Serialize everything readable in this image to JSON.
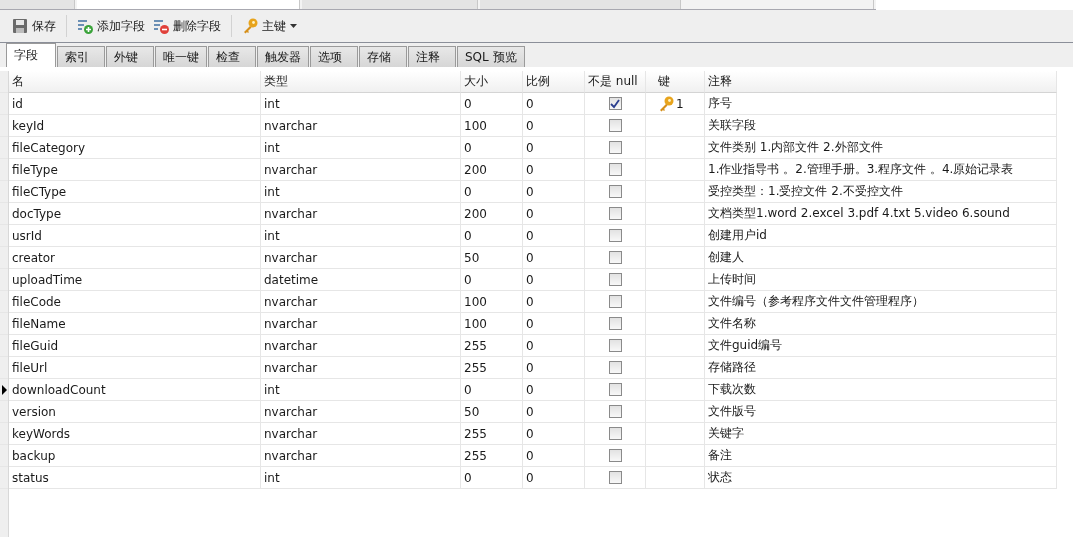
{
  "document_tabs": [
    {
      "selected": false
    },
    {
      "selected": true
    },
    {
      "selected": false
    },
    {
      "selected": false
    },
    {
      "selected": false
    }
  ],
  "toolbar": [
    {
      "kind": "save",
      "label": "保存"
    },
    {
      "kind": "separator"
    },
    {
      "kind": "add",
      "label": "添加字段"
    },
    {
      "kind": "delete",
      "label": "删除字段"
    },
    {
      "kind": "separator"
    },
    {
      "kind": "key",
      "label": "主键",
      "dropdown": true
    }
  ],
  "tabs": [
    {
      "label": "字段",
      "selected": true
    },
    {
      "label": "索引",
      "selected": false
    },
    {
      "label": "外键",
      "selected": false
    },
    {
      "label": "唯一键",
      "selected": false
    },
    {
      "label": "检查",
      "selected": false
    },
    {
      "label": "触发器",
      "selected": false
    },
    {
      "label": "选项",
      "selected": false
    },
    {
      "label": "存储",
      "selected": false
    },
    {
      "label": "注释",
      "selected": false
    },
    {
      "label": "SQL 预览",
      "selected": false
    }
  ],
  "table": {
    "columns": [
      "名",
      "类型",
      "大小",
      "比例",
      "不是 null",
      "键",
      "注释"
    ],
    "rows": [
      {
        "name": "id",
        "type": "int",
        "size": "0",
        "scale": "0",
        "not_null": true,
        "key": "1",
        "comment": "序号",
        "current": false
      },
      {
        "name": "keyId",
        "type": "nvarchar",
        "size": "100",
        "scale": "0",
        "not_null": false,
        "comment": "关联字段",
        "current": false
      },
      {
        "name": "fileCategory",
        "type": "int",
        "size": "0",
        "scale": "0",
        "not_null": false,
        "comment": "文件类别 1.内部文件 2.外部文件",
        "current": false
      },
      {
        "name": "fileType",
        "type": "nvarchar",
        "size": "200",
        "scale": "0",
        "not_null": false,
        "comment": "1.作业指导书 。2.管理手册。3.程序文件 。4.原始记录表",
        "current": false
      },
      {
        "name": "fileCType",
        "type": "int",
        "size": "0",
        "scale": "0",
        "not_null": false,
        "comment": "受控类型：1.受控文件 2.不受控文件",
        "current": false
      },
      {
        "name": "docType",
        "type": "nvarchar",
        "size": "200",
        "scale": "0",
        "not_null": false,
        "comment": "文档类型1.word 2.excel 3.pdf 4.txt 5.video 6.sound",
        "current": false
      },
      {
        "name": "usrId",
        "type": "int",
        "size": "0",
        "scale": "0",
        "not_null": false,
        "comment": "创建用户id",
        "current": false
      },
      {
        "name": "creator",
        "type": "nvarchar",
        "size": "50",
        "scale": "0",
        "not_null": false,
        "comment": "创建人",
        "current": false
      },
      {
        "name": "uploadTime",
        "type": "datetime",
        "size": "0",
        "scale": "0",
        "not_null": false,
        "comment": "上传时间",
        "current": false
      },
      {
        "name": "fileCode",
        "type": "nvarchar",
        "size": "100",
        "scale": "0",
        "not_null": false,
        "comment": "文件编号（参考程序文件文件管理程序）",
        "current": false
      },
      {
        "name": "fileName",
        "type": "nvarchar",
        "size": "100",
        "scale": "0",
        "not_null": false,
        "comment": "文件名称",
        "current": false
      },
      {
        "name": "fileGuid",
        "type": "nvarchar",
        "size": "255",
        "scale": "0",
        "not_null": false,
        "comment": "文件guid编号",
        "current": false
      },
      {
        "name": "fileUrl",
        "type": "nvarchar",
        "size": "255",
        "scale": "0",
        "not_null": false,
        "comment": "存储路径",
        "current": false
      },
      {
        "name": "downloadCount",
        "type": "int",
        "size": "0",
        "scale": "0",
        "not_null": false,
        "comment": "下载次数",
        "current": true
      },
      {
        "name": "version",
        "type": "nvarchar",
        "size": "50",
        "scale": "0",
        "not_null": false,
        "comment": "文件版号",
        "current": false
      },
      {
        "name": "keyWords",
        "type": "nvarchar",
        "size": "255",
        "scale": "0",
        "not_null": false,
        "comment": "关键字",
        "current": false
      },
      {
        "name": "backup",
        "type": "nvarchar",
        "size": "255",
        "scale": "0",
        "not_null": false,
        "comment": "备注",
        "current": false
      },
      {
        "name": "status",
        "type": "int",
        "size": "0",
        "scale": "0",
        "not_null": false,
        "comment": "状态",
        "current": false
      }
    ]
  }
}
